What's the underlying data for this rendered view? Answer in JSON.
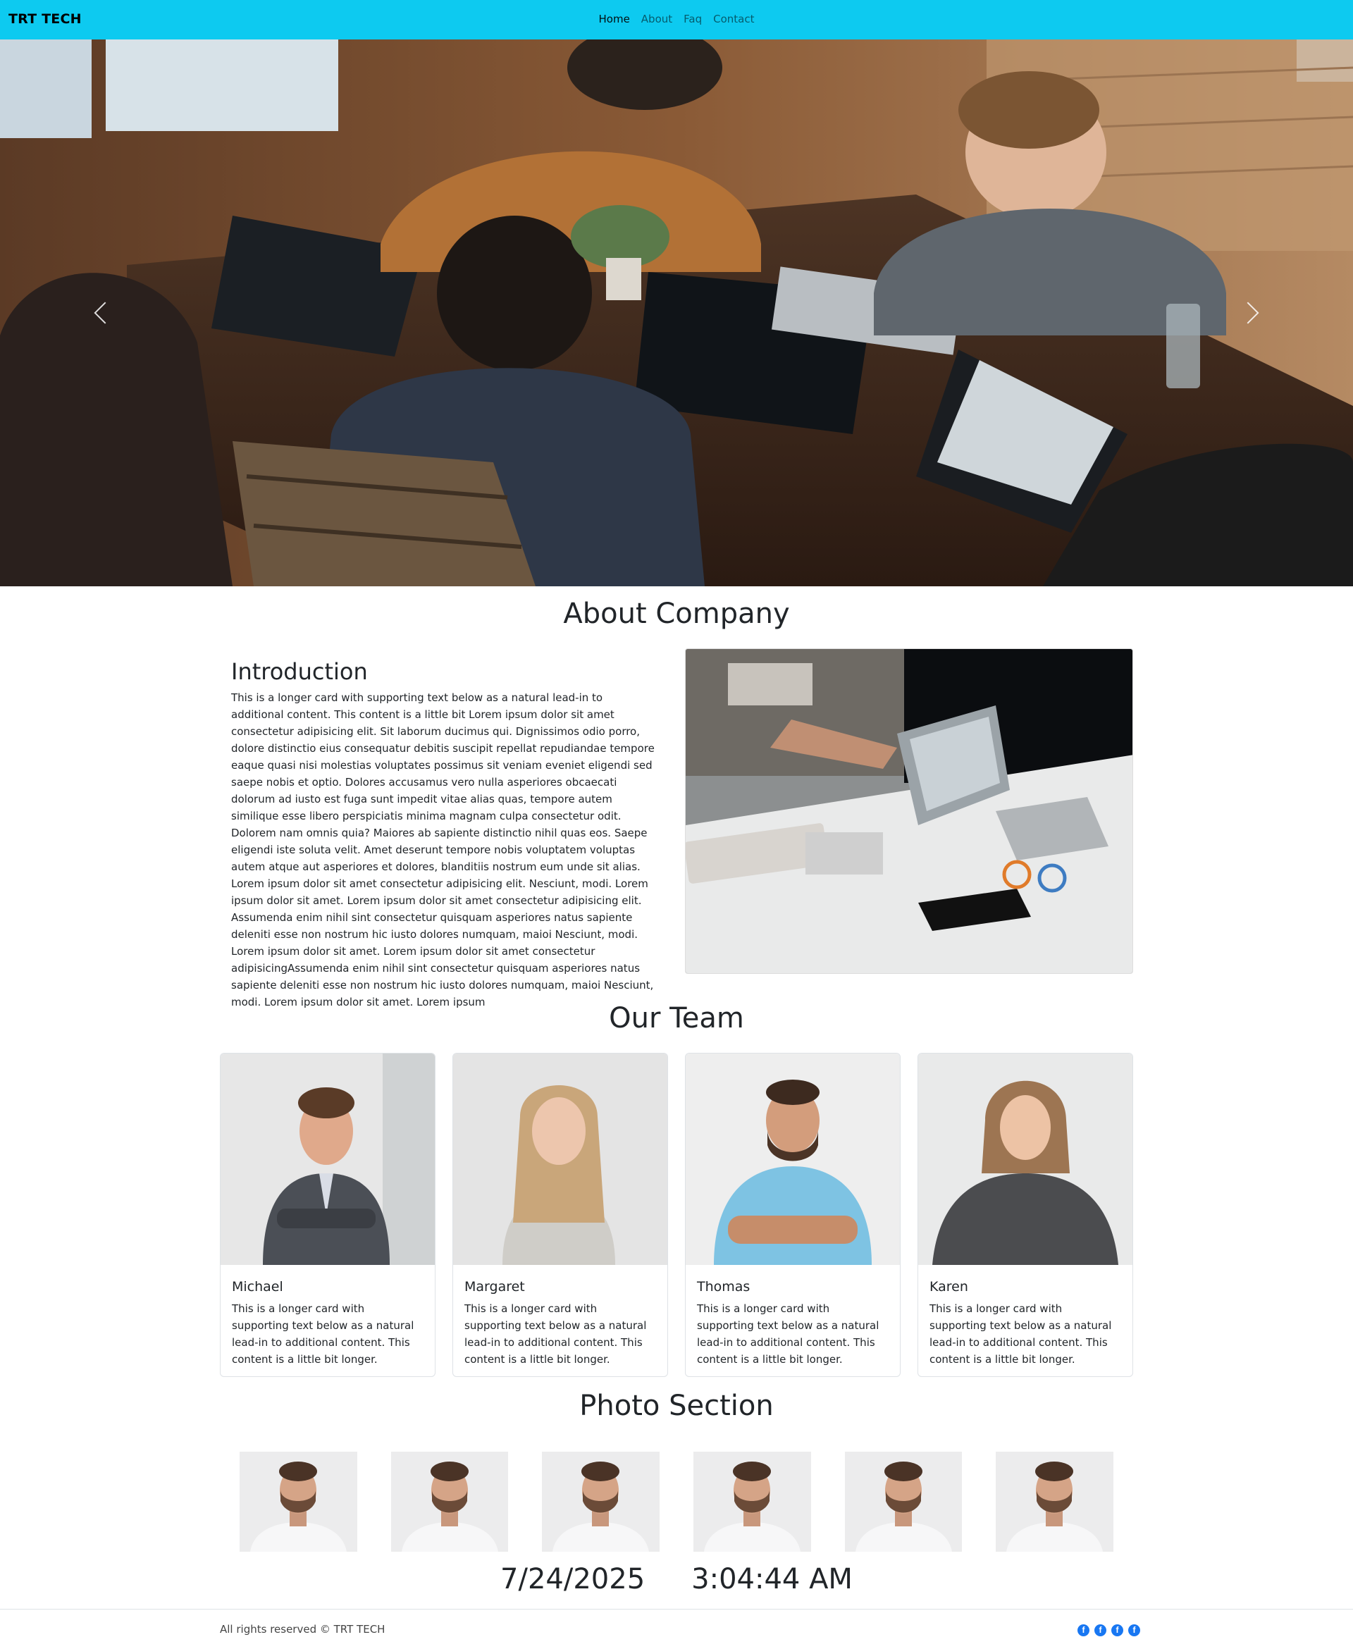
{
  "navbar": {
    "brand": "TRT TECH",
    "links": [
      "Home",
      "About",
      "Faq",
      "Contact"
    ]
  },
  "hero": {
    "slide_alt": "Team working on laptops",
    "prev_icon": "chevron-left-icon",
    "next_icon": "chevron-right-icon"
  },
  "about": {
    "section_title": "About Company",
    "heading": "Introduction",
    "body": "This is a longer card with supporting text below as a natural lead-in to additional content. This content is a little bit Lorem ipsum dolor sit amet consectetur adipisicing elit. Sit laborum ducimus qui. Dignissimos odio porro, dolore distinctio eius consequatur debitis suscipit repellat repudiandae tempore eaque quasi nisi molestias voluptates possimus sit veniam eveniet eligendi sed saepe nobis et optio. Dolores accusamus vero nulla asperiores obcaecati dolorum ad iusto est fuga sunt impedit vitae alias quas, tempore autem similique esse libero perspiciatis minima magnam culpa consectetur odit. Dolorem nam omnis quia? Maiores ab sapiente distinctio nihil quas eos. Saepe eligendi iste soluta velit. Amet deserunt tempore nobis voluptatem voluptas autem atque aut asperiores et dolores, blanditiis nostrum eum unde sit alias. Lorem ipsum dolor sit amet consectetur adipisicing elit. Nesciunt, modi. Lorem ipsum dolor sit amet. Lorem ipsum dolor sit amet consectetur adipisicing elit. Assumenda enim nihil sint consectetur quisquam asperiores natus sapiente deleniti esse non nostrum hic iusto dolores numquam, maioi Nesciunt, modi. Lorem ipsum dolor sit amet. Lorem ipsum dolor sit amet consectetur adipisicingAssumenda enim nihil sint consectetur quisquam asperiores natus sapiente deleniti esse non nostrum hic iusto dolores numquam, maioi Nesciunt, modi. Lorem ipsum dolor sit amet. Lorem ipsum"
  },
  "team": {
    "section_title": "Our Team",
    "members": [
      {
        "name": "Michael",
        "text": "This is a longer card with supporting text below as a natural lead-in to additional content. This content is a little bit longer."
      },
      {
        "name": "Margaret",
        "text": "This is a longer card with supporting text below as a natural lead-in to additional content. This content is a little bit longer."
      },
      {
        "name": "Thomas",
        "text": "This is a longer card with supporting text below as a natural lead-in to additional content. This content is a little bit longer."
      },
      {
        "name": "Karen",
        "text": "This is a longer card with supporting text below as a natural lead-in to additional content. This content is a little bit longer."
      }
    ]
  },
  "photos": {
    "section_title": "Photo Section",
    "count": 6
  },
  "clock": {
    "date": "7/24/2025",
    "time": "3:04:44 AM"
  },
  "footer": {
    "copyright": "All rights reserved © TRT TECH",
    "social_icons": [
      "facebook-icon",
      "facebook-icon",
      "facebook-icon",
      "facebook-icon"
    ],
    "social_glyph": "f"
  },
  "colors": {
    "navbar": "#0dcaf0",
    "social": "#1877f2"
  }
}
